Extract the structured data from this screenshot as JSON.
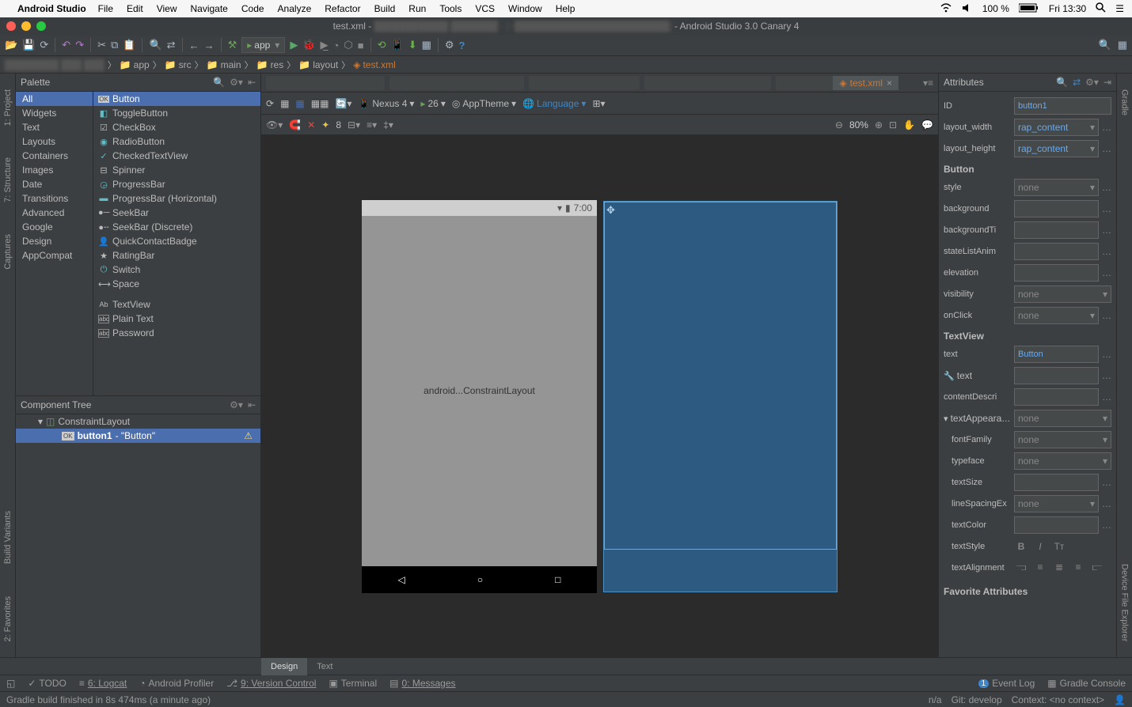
{
  "menubar": {
    "appname": "Android Studio",
    "items": [
      "File",
      "Edit",
      "View",
      "Navigate",
      "Code",
      "Analyze",
      "Refactor",
      "Build",
      "Run",
      "Tools",
      "VCS",
      "Window",
      "Help"
    ],
    "battery": "100 %",
    "clock": "Fri 13:30"
  },
  "title_bar": {
    "title_file": "test.xml - ",
    "title_suffix": " - Android Studio 3.0 Canary 4"
  },
  "toolbar": {
    "run_config": "app"
  },
  "breadcrumbs": [
    "app",
    "src",
    "main",
    "res",
    "layout",
    "test.xml"
  ],
  "editor_tab": "test.xml",
  "palette": {
    "title": "Palette",
    "categories": [
      "All",
      "Widgets",
      "Text",
      "Layouts",
      "Containers",
      "Images",
      "Date",
      "Transitions",
      "Advanced",
      "Google",
      "Design",
      "AppCompat"
    ],
    "widgets": [
      "Button",
      "ToggleButton",
      "CheckBox",
      "RadioButton",
      "CheckedTextView",
      "Spinner",
      "ProgressBar",
      "ProgressBar (Horizontal)",
      "SeekBar",
      "SeekBar (Discrete)",
      "QuickContactBadge",
      "RatingBar",
      "Switch",
      "Space"
    ],
    "text_widgets": [
      "TextView",
      "Plain Text",
      "Password"
    ]
  },
  "component_tree": {
    "title": "Component Tree",
    "root": "ConstraintLayout",
    "child_id": "button1",
    "child_label": " - \"Button\""
  },
  "design_toolbar": {
    "device": "Nexus 4",
    "api": "26",
    "theme": "AppTheme",
    "lang": "Language",
    "zoom": "80%",
    "filter_pct": "8"
  },
  "canvas": {
    "status_time": "7:00",
    "content_label": "android...ConstraintLayout"
  },
  "attributes": {
    "title": "Attributes",
    "id": "button1",
    "layout_width": "rap_content",
    "layout_height": "rap_content",
    "section_button": "Button",
    "style": "none",
    "background": "",
    "backgroundTint": "",
    "stateListAnim": "",
    "elevation": "",
    "visibility": "none",
    "onClick": "none",
    "section_textview": "TextView",
    "text": "Button",
    "text2": "",
    "contentDescri": "",
    "textAppearance": "none",
    "fontFamily": "none",
    "typeface": "none",
    "textSize": "",
    "lineSpacingEx": "none",
    "textColor": "",
    "section_fav": "Favorite Attributes",
    "labels": {
      "id": "ID",
      "layout_width": "layout_width",
      "layout_height": "layout_height",
      "style": "style",
      "background": "background",
      "backgroundTint": "backgroundTi",
      "stateListAnim": "stateListAnim",
      "elevation": "elevation",
      "visibility": "visibility",
      "onClick": "onClick",
      "text": "text",
      "text2": "text",
      "contentDescri": "contentDescri",
      "textAppearance": "textAppearance",
      "fontFamily": "fontFamily",
      "typeface": "typeface",
      "textSize": "textSize",
      "lineSpacingEx": "lineSpacingEx",
      "textColor": "textColor",
      "textStyle": "textStyle",
      "textAlignment": "textAlignment"
    }
  },
  "bottom_tabs": {
    "design": "Design",
    "text": "Text"
  },
  "tool_windows": {
    "todo": "TODO",
    "logcat": "6: Logcat",
    "profiler": "Android Profiler",
    "vcs": "9: Version Control",
    "terminal": "Terminal",
    "messages": "0: Messages",
    "event_log": "Event Log",
    "gradle_console": "Gradle Console"
  },
  "left_strip": {
    "project": "1: Project",
    "structure": "7: Structure",
    "captures": "Captures",
    "build_variants": "Build Variants",
    "favorites": "2: Favorites"
  },
  "right_strip": {
    "gradle": "Gradle",
    "dfe": "Device File Explorer"
  },
  "status": {
    "msg": "Gradle build finished in 8s 474ms (a minute ago)",
    "na": "n/a",
    "git": "Git: develop",
    "context": "Context: <no context>"
  }
}
